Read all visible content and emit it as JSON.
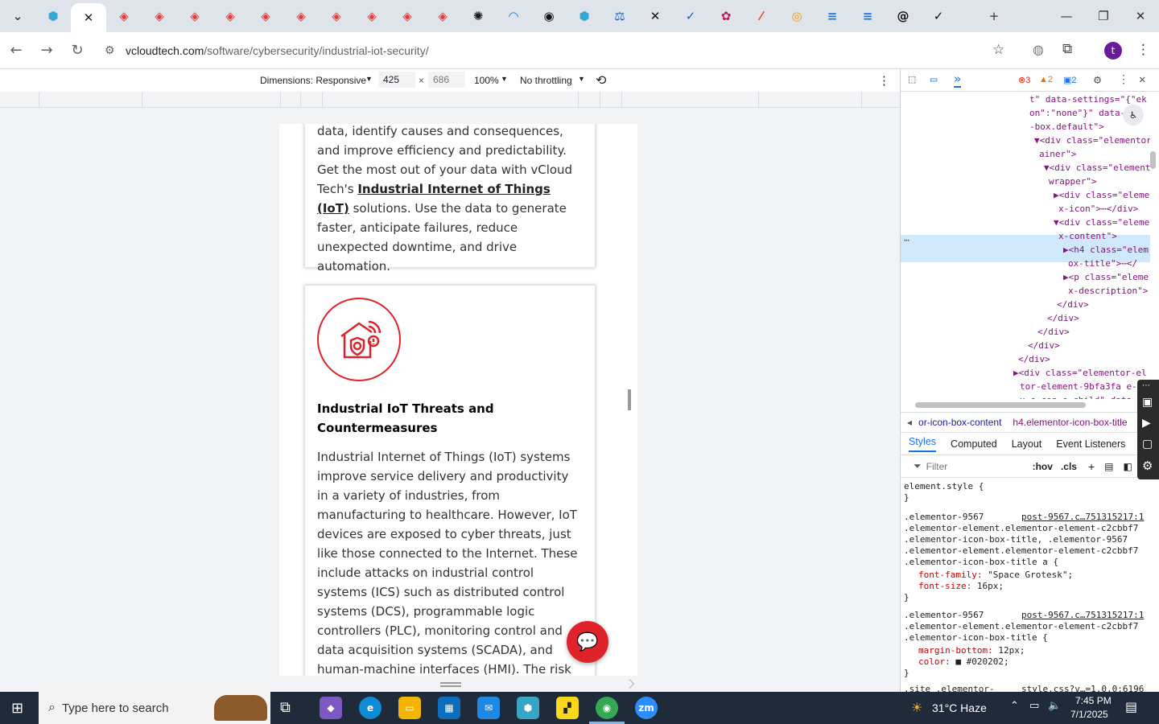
{
  "browser": {
    "url_domain": "vcloudtech.com",
    "url_path": "/software/cybersecurity/industrial-iot-security/"
  },
  "tabs": [
    {
      "icon": "tab-search-icon",
      "color": "#3c4043",
      "glyph": "⌄"
    },
    {
      "icon": "hexagon-app-icon",
      "color": "#35a7d4",
      "glyph": "⬢"
    },
    {
      "icon": "close-tab-icon",
      "color": "#202124",
      "glyph": "✕"
    },
    {
      "icon": "red-diamond-icon",
      "color": "#e53935",
      "glyph": "◈"
    },
    {
      "icon": "red-diamond-icon",
      "color": "#e53935",
      "glyph": "◈"
    },
    {
      "icon": "red-diamond-icon",
      "color": "#e53935",
      "glyph": "◈"
    },
    {
      "icon": "red-diamond-icon",
      "color": "#e53935",
      "glyph": "◈"
    },
    {
      "icon": "red-diamond-icon",
      "color": "#e53935",
      "glyph": "◈"
    },
    {
      "icon": "red-diamond-icon",
      "color": "#e53935",
      "glyph": "◈"
    },
    {
      "icon": "red-diamond-icon",
      "color": "#e53935",
      "glyph": "◈"
    },
    {
      "icon": "red-diamond-icon",
      "color": "#e53935",
      "glyph": "◈"
    },
    {
      "icon": "red-diamond-icon",
      "color": "#e53935",
      "glyph": "◈"
    },
    {
      "icon": "red-diamond-icon",
      "color": "#e53935",
      "glyph": "◈"
    },
    {
      "icon": "openai-icon",
      "color": "#111111",
      "glyph": "✺"
    },
    {
      "icon": "wave-icon",
      "color": "#1976d2",
      "glyph": "◠"
    },
    {
      "icon": "spiral-icon",
      "color": "#111111",
      "glyph": "◉"
    },
    {
      "icon": "hexagon-app-icon",
      "color": "#35a7d4",
      "glyph": "⬢"
    },
    {
      "icon": "balance-icon",
      "color": "#1565c0",
      "glyph": "⚖"
    },
    {
      "icon": "x-brand-icon",
      "color": "#111111",
      "glyph": "✕"
    },
    {
      "icon": "checkmark-swoosh-icon",
      "color": "#1565c0",
      "glyph": "✓"
    },
    {
      "icon": "pink-app-icon",
      "color": "#c2185b",
      "glyph": "✿"
    },
    {
      "icon": "slash-app-icon",
      "color": "#e64a19",
      "glyph": "⁄"
    },
    {
      "icon": "color-ring-icon",
      "color": "#ff9800",
      "glyph": "◎"
    },
    {
      "icon": "forms-icon",
      "color": "#1a73e8",
      "glyph": "≡"
    },
    {
      "icon": "forms-icon",
      "color": "#1a73e8",
      "glyph": "≡"
    },
    {
      "icon": "threads-icon",
      "color": "#111111",
      "glyph": "@"
    },
    {
      "icon": "check-icon",
      "color": "#111111",
      "glyph": "✓"
    }
  ],
  "devbar": {
    "dimensions": "Dimensions: Responsive",
    "width": "425",
    "times": "×",
    "height": "686",
    "zoom": "100%",
    "throttle": "No throttling"
  },
  "page": {
    "card1_text_a": "data, identify causes and consequences, and improve efficiency and predictability. Get the most out of your data with vCloud Tech's ",
    "card1_link": "Industrial Internet of Things (IoT)",
    "card1_text_b": " solutions. Use the data to generate faster, anticipate failures, reduce unexpected downtime, and drive automation.",
    "card2_title": "Industrial IoT Threats and Countermeasures",
    "card2_text": "Industrial Internet of Things (IoT) systems improve service delivery and productivity in a variety of industries, from manufacturing to healthcare. However, IoT devices are exposed to cyber threats, just like those connected to the Internet. These include attacks on industrial control systems (ICS) such as distributed control systems (DCS), programmable logic controllers (PLC), monitoring control and data acquisition systems (SCADA), and human-machine interfaces (HMI). The risk"
  },
  "devtools": {
    "errors": "3",
    "warnings": "2",
    "messages": "2",
    "crumb1": "or-icon-box-content",
    "crumb2": "h4.elementor-icon-box-title",
    "tab_styles": "Styles",
    "tab_computed": "Computed",
    "tab_layout": "Layout",
    "tab_listeners": "Event Listeners",
    "filter_placeholder": "Filter",
    "hov": ":hov",
    "cls": ".cls",
    "code_lines": [
      "t\" data-settings=\"{\"ek",
      "on\":\"none\"}\" data-\"g",
      "-box.default\">",
      "▼<div class=\"elementor",
      "ainer\">",
      "▼<div class=\"element",
      "wrapper\">",
      "▶<div class=\"eleme",
      "x-icon\">⋯</div>",
      "▼<div class=\"eleme",
      "x-content\">",
      "▶<h4 class=\"elem",
      "ox-title\">⋯</",
      "▶<p class=\"eleme",
      "x-description\">",
      "</div>",
      "</div>",
      "</div>",
      "</div>",
      "</div>",
      "▶<div class=\"elementor-el",
      "tor-element-9bfa3fa e-co",
      "x e-con e-child\" data-"
    ],
    "style_lines": [
      "element.style {",
      "}",
      ".elementor-9567",
      "post-9567.c…751315217:1",
      ".elementor-element.elementor-element-c2cbbf7",
      ".elementor-icon-box-title, .elementor-9567",
      ".elementor-element.elementor-element-c2cbbf7",
      ".elementor-icon-box-title a {",
      "font-family: \"Space Grotesk\";",
      "font-size: 16px;",
      "}",
      ".elementor-9567",
      "post-9567.c…751315217:1",
      ".elementor-element.elementor-element-c2cbbf7",
      ".elementor-icon-box-title {",
      "margin-bottom: 12px;",
      "color: ■ #020202;",
      "}",
      ".site .elementor-",
      "style.css?v…=1.0.0:6196"
    ]
  },
  "taskbar": {
    "search_placeholder": "Type here to search",
    "weather": "31°C  Haze",
    "time": "7:45 PM",
    "date": "7/1/2025"
  }
}
